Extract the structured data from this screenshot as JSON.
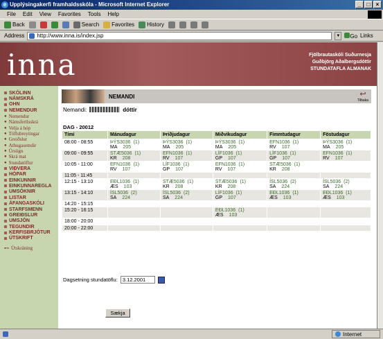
{
  "window": {
    "title": "Upplýsingakerfi framhaldsskóla - Microsoft Internet Explorer",
    "buttons": [
      "_",
      "□",
      "×"
    ]
  },
  "menu": [
    "File",
    "Edit",
    "View",
    "Favorites",
    "Tools",
    "Help"
  ],
  "toolbar": {
    "back": "Back",
    "search": "Search",
    "favorites": "Favorites",
    "history": "History"
  },
  "address": {
    "label": "Address",
    "url": "http://www.inna.is/index.jsp",
    "go": "Go",
    "links": "Links"
  },
  "status": {
    "zone": "Internet"
  },
  "banner": {
    "logo": "inna",
    "school": "Fjölbrautaskóli Suðurnesja",
    "user": "Guðbjörg Aðalbergsdóttir",
    "sub": "STUNDATAFLA ALMANAK"
  },
  "sidebar": [
    {
      "type": "main",
      "label": "SKÓLINN"
    },
    {
      "type": "main",
      "label": "NÁMSKRÁ"
    },
    {
      "type": "main",
      "label": "OHN"
    },
    {
      "type": "main",
      "label": "NEMENDUR"
    },
    {
      "type": "sub",
      "label": "Nemendur"
    },
    {
      "type": "sub",
      "label": "Námsferilsskrá"
    },
    {
      "type": "sub",
      "label": "Velja á hóp"
    },
    {
      "type": "sub",
      "label": "Töflubreytingar"
    },
    {
      "type": "sub",
      "label": "Greiðslur"
    },
    {
      "type": "sub",
      "label": "Athugasemdir"
    },
    {
      "type": "sub",
      "label": "Úrsögn"
    },
    {
      "type": "sub",
      "label": "Skrá mat"
    },
    {
      "type": "sub",
      "label": "Stundatöflur"
    },
    {
      "type": "main",
      "label": "VIÐVERA"
    },
    {
      "type": "main",
      "label": "HÓPAR"
    },
    {
      "type": "main",
      "label": "EINKUNNIR"
    },
    {
      "type": "main",
      "label": "EINKUNNAREGLA"
    },
    {
      "type": "main",
      "label": "UMSÓKNIR"
    },
    {
      "type": "main",
      "label": "LISTAR"
    },
    {
      "type": "main",
      "label": "ÁFANGASKÓLI"
    },
    {
      "type": "main",
      "label": "STARFSMENN"
    },
    {
      "type": "main",
      "label": "GREIÐSLUR"
    },
    {
      "type": "main",
      "label": "UMSJÓN"
    },
    {
      "type": "main",
      "label": "TEGUNDIR"
    },
    {
      "type": "main",
      "label": "KERFISBRJÓTUR"
    },
    {
      "type": "main",
      "label": "ÚTSKRIFT"
    }
  ],
  "logout": "Útskráning",
  "page": {
    "title": "NEMANDI",
    "back": "Tilbaka",
    "nemandi_label": "Nemandi:",
    "nemandi_name": "dóttir",
    "dag_header": "DAG - 20012"
  },
  "timetable": {
    "headers": [
      "Tími",
      "Mánudagur",
      "Þriðjudagur",
      "Miðvikudagur",
      "Fimmtudagur",
      "Föstudagur"
    ],
    "rows": [
      {
        "time": "08:00 - 08:55",
        "cells": [
          {
            "code": "ÞÝS3036",
            "grp": "(1)",
            "teacher": "MA",
            "room": "205"
          },
          {
            "code": "ÞÝS3036",
            "grp": "(1)",
            "teacher": "MA",
            "room": "205"
          },
          {
            "code": "ÞÝS3036",
            "grp": "(1)",
            "teacher": "MA",
            "room": "205"
          },
          {
            "code": "EFN1036",
            "grp": "(1)",
            "teacher": "RV",
            "room": "107"
          },
          {
            "code": "ÞÝS3036",
            "grp": "(1)",
            "teacher": "MA",
            "room": "205"
          }
        ]
      },
      {
        "time": "09:00 - 09:55",
        "cells": [
          {
            "code": "STÆ5036",
            "grp": "(1)",
            "teacher": "KR",
            "room": "208"
          },
          {
            "code": "EFN1036",
            "grp": "(1)",
            "teacher": "RV",
            "room": "107"
          },
          {
            "code": "LÍF1036",
            "grp": "(1)",
            "teacher": "GP",
            "room": "107"
          },
          {
            "code": "LÍF1036",
            "grp": "(1)",
            "teacher": "GP",
            "room": "107"
          },
          {
            "code": "EFN1036",
            "grp": "(1)",
            "teacher": "RV",
            "room": "107"
          }
        ]
      },
      {
        "time": "10:05 - 11:00",
        "cells": [
          {
            "code": "EFN1036",
            "grp": "(1)",
            "teacher": "RV",
            "room": "107"
          },
          {
            "code": "LÍF1036",
            "grp": "(1)",
            "teacher": "GP",
            "room": "107"
          },
          {
            "code": "EFN1036",
            "grp": "(1)",
            "teacher": "RV",
            "room": "107"
          },
          {
            "code": "STÆ5036",
            "grp": "(1)",
            "teacher": "KR",
            "room": "208"
          },
          null
        ]
      },
      {
        "time": "11:05 - 11:45",
        "cells": [
          null,
          null,
          null,
          null,
          null
        ]
      },
      {
        "time": "12:15 - 13:10",
        "cells": [
          {
            "code": "EÐL1036",
            "grp": "(1)",
            "teacher": "ÆS",
            "room": "103"
          },
          {
            "code": "STÆ5036",
            "grp": "(1)",
            "teacher": "KR",
            "room": "208"
          },
          {
            "code": "STÆ5036",
            "grp": "(1)",
            "teacher": "KR",
            "room": "208"
          },
          {
            "code": "ÍSL5036",
            "grp": "(2)",
            "teacher": "SA",
            "room": "224"
          },
          {
            "code": "ÍSL5036",
            "grp": "(2)",
            "teacher": "SA",
            "room": "224"
          }
        ]
      },
      {
        "time": "13:15 - 14:10",
        "cells": [
          {
            "code": "ÍSL5036",
            "grp": "(2)",
            "teacher": "SA",
            "room": "224"
          },
          {
            "code": "ÍSL5036",
            "grp": "(2)",
            "teacher": "SA",
            "room": "224"
          },
          {
            "code": "LÍF1036",
            "grp": "(1)",
            "teacher": "GP",
            "room": "107"
          },
          {
            "code": "EÐL1036",
            "grp": "(1)",
            "teacher": "ÆS",
            "room": "103"
          },
          {
            "code": "EÐL1036",
            "grp": "(1)",
            "teacher": "ÆS",
            "room": "103"
          }
        ]
      },
      {
        "time": "14:20 - 15:15",
        "cells": [
          null,
          null,
          null,
          null,
          null
        ]
      },
      {
        "time": "15:20 - 16:15",
        "cells": [
          null,
          null,
          {
            "code": "EÐL1036",
            "grp": "(1)",
            "teacher": "ÆS",
            "room": "103"
          },
          null,
          null
        ]
      },
      {
        "time": "18:00 - 20:00",
        "cells": [
          null,
          null,
          null,
          null,
          null
        ]
      },
      {
        "time": "20:00 - 22:00",
        "cells": [
          null,
          null,
          null,
          null,
          null
        ]
      }
    ]
  },
  "date_field": {
    "label": "Dagsetning stundatöflu:",
    "value": "3.12.2001"
  },
  "submit": "Sækja"
}
